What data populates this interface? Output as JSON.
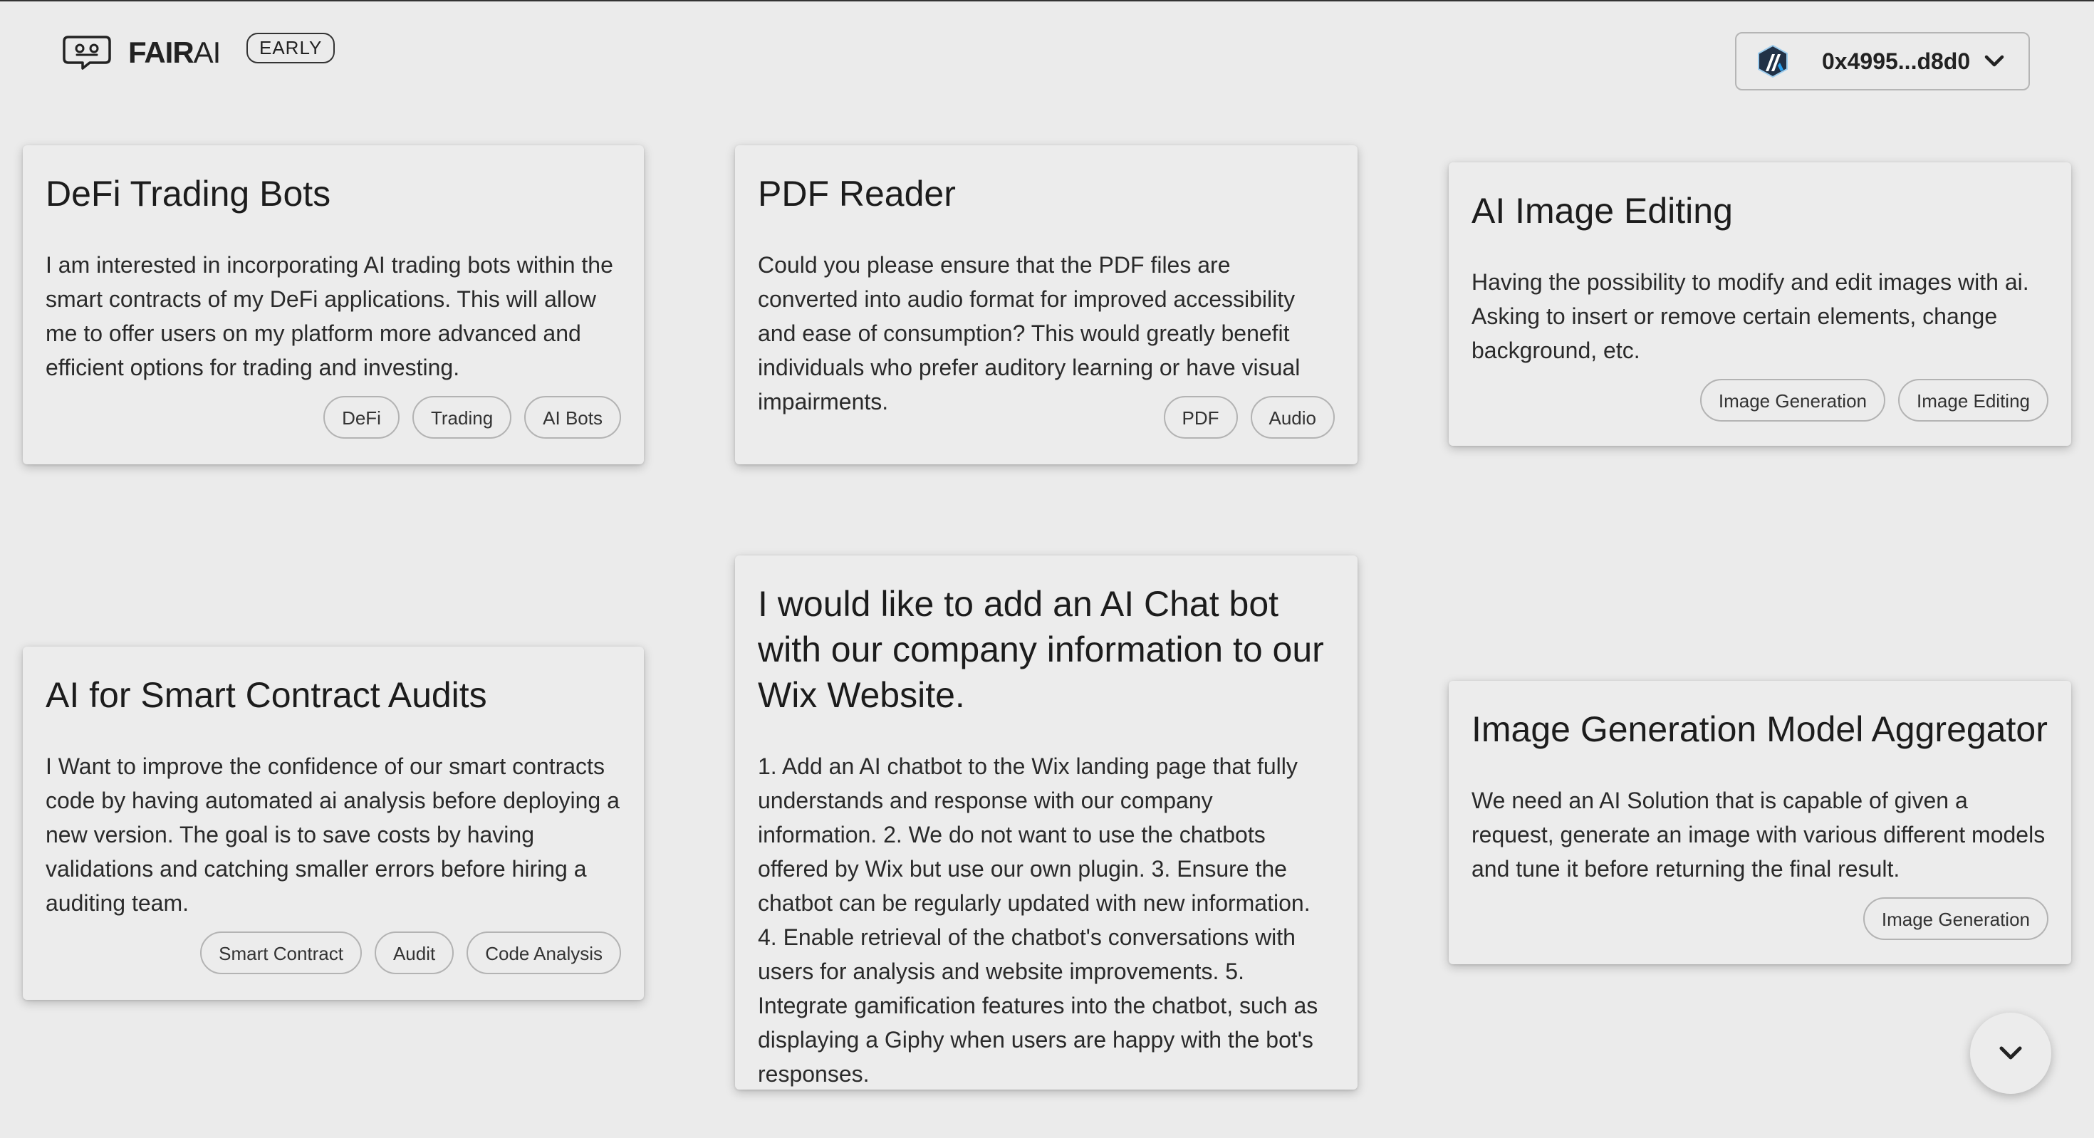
{
  "header": {
    "logo_bold": "FAIR",
    "logo_light": "AI",
    "badge": "EARLY",
    "wallet_address": "0x4995...d8d0"
  },
  "cards": [
    {
      "title": "DeFi Trading Bots",
      "description": "I am interested in incorporating AI trading bots within the smart contracts of my DeFi applications. This will allow me to offer users on my platform more advanced and efficient options for trading and investing.",
      "tags": [
        "DeFi",
        "Trading",
        "AI Bots"
      ]
    },
    {
      "title": "PDF Reader",
      "description": "Could you please ensure that the PDF files are converted into audio format for improved accessibility and ease of consumption? This would greatly benefit individuals who prefer auditory learning or have visual impairments.",
      "tags": [
        "PDF",
        "Audio"
      ]
    },
    {
      "title": "AI Image Editing",
      "description": "Having the possibility to modify and edit images with ai. Asking to insert or remove certain elements, change background, etc.",
      "tags": [
        "Image Generation",
        "Image Editing"
      ]
    },
    {
      "title": "AI for Smart Contract Audits",
      "description": "I Want to improve the confidence of our smart contracts code by having automated ai analysis before deploying a new version. The goal is to save costs by having validations and catching smaller errors before hiring a auditing team.",
      "tags": [
        "Smart Contract",
        "Audit",
        "Code Analysis"
      ]
    },
    {
      "title": "I would like to add an AI Chat bot with our company information to our Wix Website.",
      "description": "1. Add an AI chatbot to the Wix landing page that fully understands and response with our company information. 2. We do not want to use the chatbots offered by Wix but use our own plugin. 3. Ensure the chatbot can be regularly updated with new information. 4. Enable retrieval of the chatbot's conversations with users for analysis and website improvements. 5. Integrate gamification features into the chatbot, such as displaying a Giphy when users are happy with the bot's responses.",
      "tags": []
    },
    {
      "title": "Image Generation Model Aggregator",
      "description": "We need an AI Solution that is capable of given a request, generate an image with various different models and tune it before returning the final result.",
      "tags": [
        "Image Generation"
      ]
    }
  ]
}
